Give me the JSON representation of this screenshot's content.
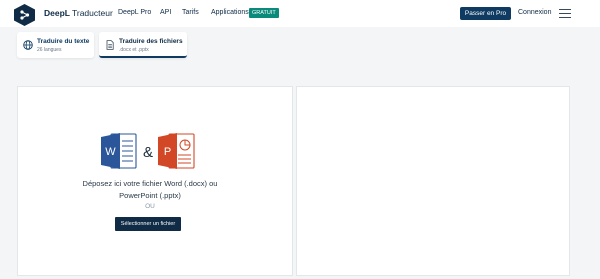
{
  "header": {
    "brand": "DeepL",
    "brand_sub": "Traducteur",
    "nav": {
      "pro": "DeepL Pro",
      "api": "API",
      "tarifs": "Tarifs",
      "apps": "Applications"
    },
    "badge": "GRATUIT",
    "btn_pro": "Passer en Pro",
    "connexion": "Connexion"
  },
  "tabs": [
    {
      "title": "Traduire du texte",
      "sub": "26 langues"
    },
    {
      "title": "Traduire des fichiers",
      "sub": ".docx et .pptx"
    }
  ],
  "upload": {
    "ampersand": "&",
    "line1": "Déposez ici votre fichier Word (.docx) ou",
    "line2": "PowerPoint (.pptx)",
    "ou": "OU",
    "button": "Sélectionner un fichier"
  },
  "colors": {
    "brand_dark": "#0f2b46",
    "brand_blue": "#0f3b63",
    "badge": "#0a8a7a",
    "word": "#2b579a",
    "powerpoint": "#d24726"
  }
}
